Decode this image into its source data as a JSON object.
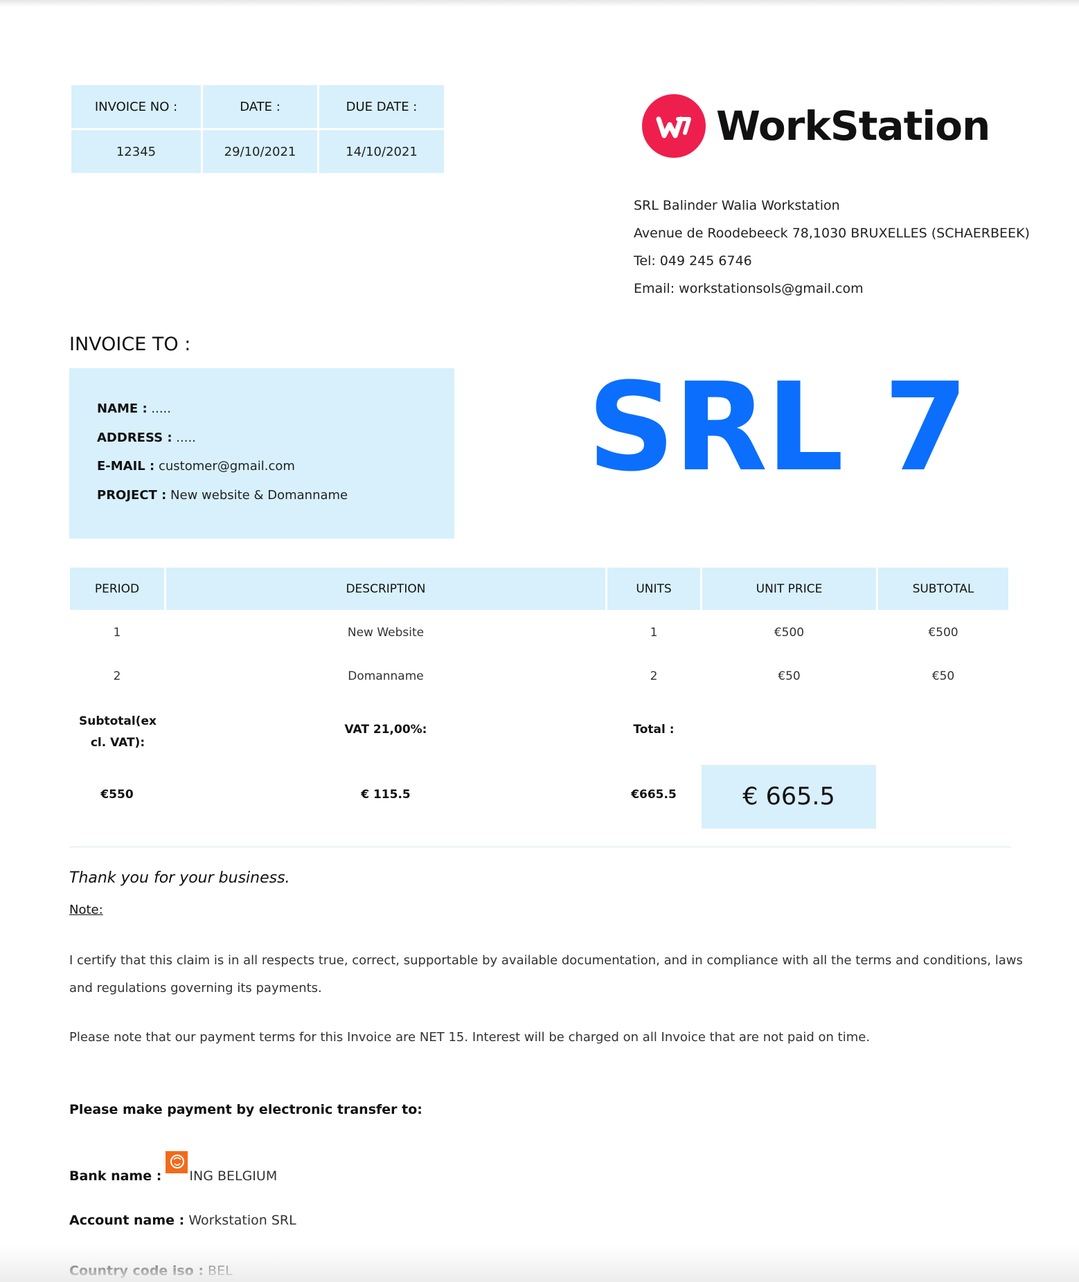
{
  "invoice_meta": {
    "headers": [
      "INVOICE NO :",
      "DATE :",
      "DUE DATE :"
    ],
    "values": [
      "12345",
      "29/10/2021",
      "14/10/2021"
    ]
  },
  "company": {
    "logo_text": "WorkStation",
    "lines": [
      "SRL Balinder Walia Workstation",
      "Avenue de Roodebeeck 78,1030 BRUXELLES (SCHAERBEEK)",
      "Tel: 049 245 6746",
      "Email: workstationsols@gmail.com"
    ],
    "brand_color": "#ee1f4d"
  },
  "invoice_to": {
    "heading": "INVOICE TO :",
    "fields": [
      {
        "label": "NAME :",
        "value": " ....."
      },
      {
        "label": "ADDRESS :",
        "value": " ....."
      },
      {
        "label": "E-MAIL :",
        "value": " customer@gmail.com"
      },
      {
        "label": "PROJECT :",
        "value": " New website & Domanname"
      }
    ]
  },
  "big_title": "SRL 7",
  "accent_color": "#0b6efd",
  "table": {
    "headers": [
      "PERIOD",
      "DESCRIPTION",
      "UNITS",
      "UNIT PRICE",
      "SUBTOTAL"
    ],
    "rows": [
      [
        "1",
        "New Website",
        "1",
        "€500",
        "€500"
      ],
      [
        "2",
        "Domanname",
        "2",
        "€50",
        "€50"
      ]
    ]
  },
  "summary": {
    "subtotal_label": "Subtotal(ex cl. VAT):",
    "vat_label": "VAT 21,00%:",
    "total_label": "Total :",
    "subtotal_value": "€550",
    "vat_value": "€ 115.5",
    "total_value": "€665.5",
    "grand_total": "€ 665.5"
  },
  "footer": {
    "thanks": "Thank you for your business.",
    "note_label": "Note:",
    "certify": "I certify that this claim is in all respects true, correct, supportable by available documentation, and in compliance with all the terms and conditions, laws and regulations governing its payments.",
    "payment_terms": "Please note that our payment terms for this Invoice are NET 15. Interest will be charged on all Invoice that are not paid on time.",
    "pay_heading": "Please make payment by electronic transfer to:",
    "bank_label": "Bank name :",
    "bank_value": "ING BELGIUM",
    "account_label": "Account name :",
    "account_value": " Workstation SRL",
    "country_label": "Country code iso :",
    "country_value": " BEL"
  }
}
